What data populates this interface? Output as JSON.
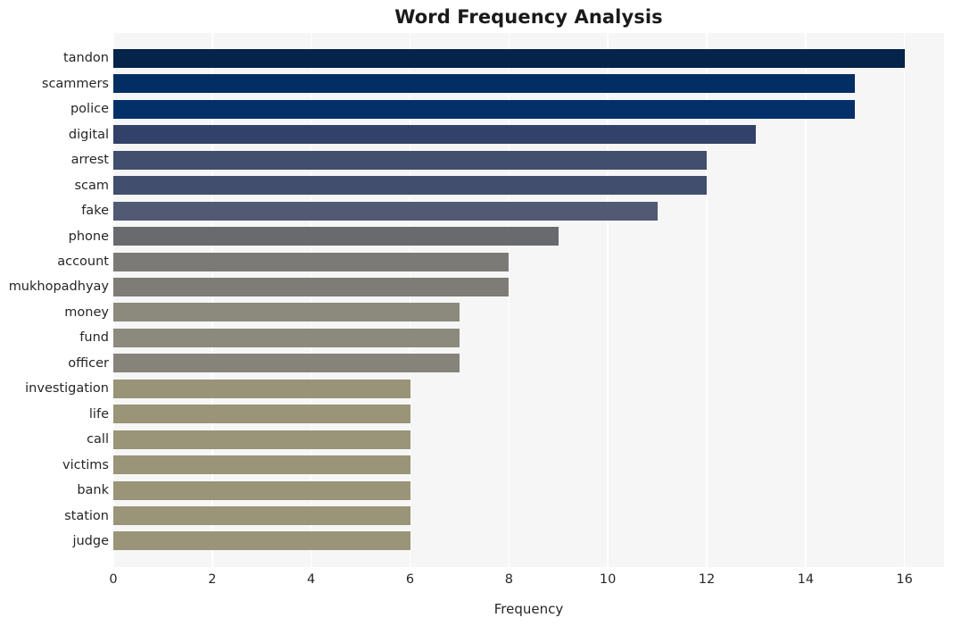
{
  "chart_data": {
    "type": "bar",
    "orientation": "horizontal",
    "title": "Word Frequency Analysis",
    "xlabel": "Frequency",
    "ylabel": "",
    "xlim": [
      0,
      16.8
    ],
    "ylim_categories": 20,
    "grid": "vertical-only",
    "legend": "none",
    "background": "#f6f6f6",
    "gridline_color": "#ffffff",
    "categories": [
      "tandon",
      "scammers",
      "police",
      "digital",
      "arrest",
      "scam",
      "fake",
      "phone",
      "account",
      "mukhopadhyay",
      "money",
      "fund",
      "officer",
      "investigation",
      "life",
      "call",
      "victims",
      "bank",
      "station",
      "judge"
    ],
    "values": [
      16,
      15,
      15,
      13,
      12,
      12,
      11,
      9,
      8,
      8,
      7,
      7,
      7,
      6,
      6,
      6,
      6,
      6,
      6,
      6
    ],
    "bar_colors": [
      "#042449",
      "#032e63",
      "#04306a",
      "#324169",
      "#414e6d",
      "#414e6d",
      "#525972",
      "#696a6e",
      "#7b7a76",
      "#7d7c77",
      "#8c8a7d",
      "#8c8a7d",
      "#85837a",
      "#999377",
      "#9a9478",
      "#9a9478",
      "#9a9478",
      "#9a9478",
      "#9a9478",
      "#9a9478"
    ],
    "xticks": [
      0,
      2,
      4,
      6,
      8,
      10,
      12,
      14,
      16
    ],
    "xtick_labels": [
      "0",
      "2",
      "4",
      "6",
      "8",
      "10",
      "12",
      "14",
      "16"
    ]
  }
}
